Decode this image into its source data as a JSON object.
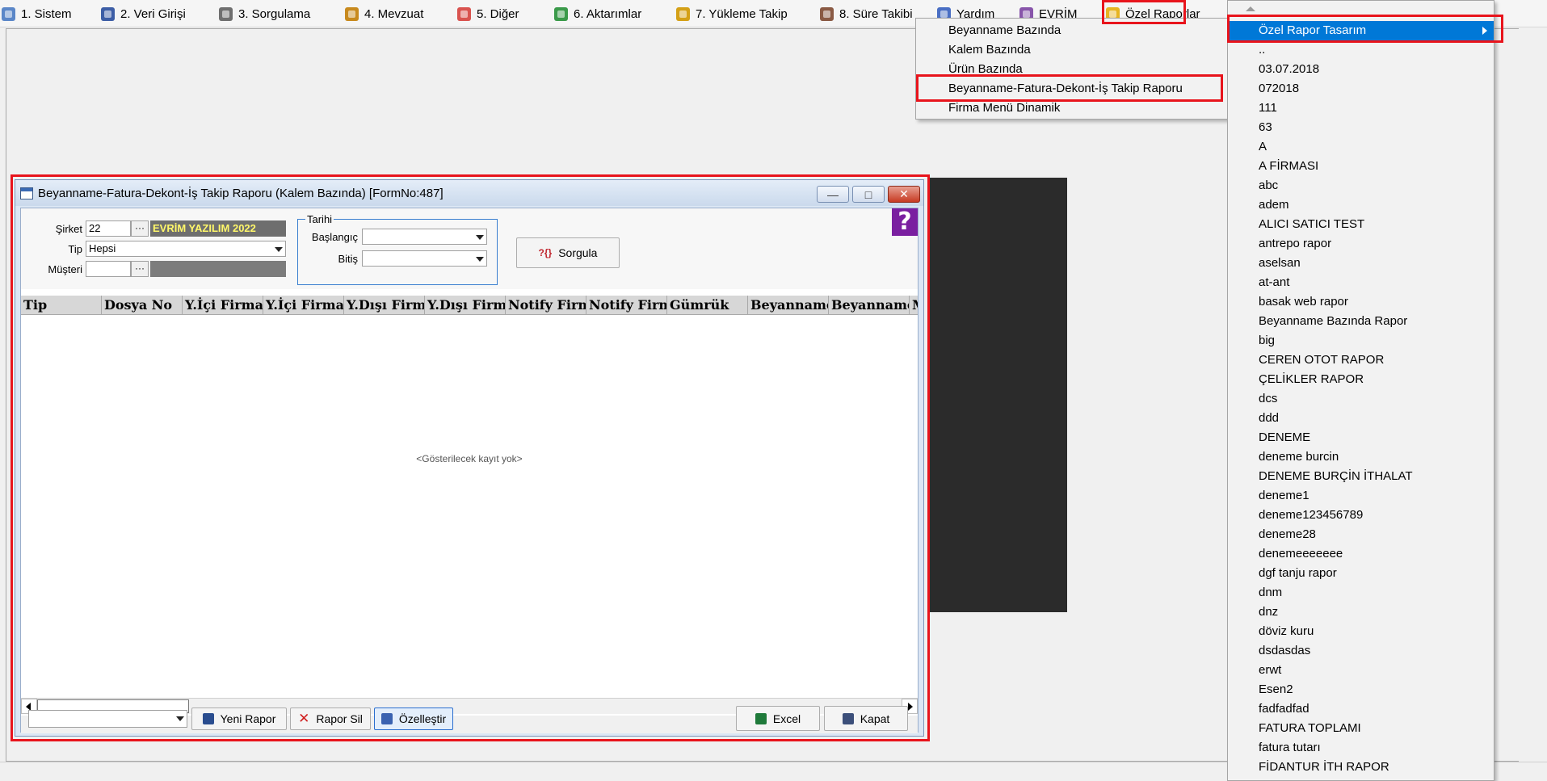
{
  "menubar": {
    "items": [
      {
        "label": "1.  Sistem"
      },
      {
        "label": "2.  Veri Girişi"
      },
      {
        "label": "3.  Sorgulama"
      },
      {
        "label": "4.  Mevzuat"
      },
      {
        "label": "5.  Diğer"
      },
      {
        "label": "6.  Aktarımlar"
      },
      {
        "label": "7.  Yükleme Takip"
      },
      {
        "label": "8. Süre Takibi"
      },
      {
        "label": "Yardım"
      },
      {
        "label": "EVRİM"
      },
      {
        "label": "Özel Raporlar"
      }
    ]
  },
  "ozel_raporlar_menu": {
    "items": [
      "Beyanname Bazında",
      "Kalem Bazında",
      "Ürün Bazında",
      "Beyanname-Fatura-Dekont-İş Takip Raporu",
      "Firma Menü Dinamik"
    ]
  },
  "submenu": {
    "items": [
      "Özel Rapor Tasarım",
      "..",
      "03.07.2018",
      "072018",
      "111",
      "63",
      "A",
      "A FİRMASI",
      "abc",
      "adem",
      "ALICI SATICI TEST",
      "antrepo rapor",
      "aselsan",
      "at-ant",
      "basak web rapor",
      "Beyanname Bazında Rapor",
      "big",
      "CEREN OTOT RAPOR",
      "ÇELİKLER RAPOR",
      "dcs",
      "ddd",
      "DENEME",
      "deneme burcin",
      "DENEME BURÇİN İTHALAT",
      "deneme1",
      "deneme123456789",
      "deneme28",
      "denemeeeeeee",
      "dgf tanju rapor",
      "dnm",
      "dnz",
      "döviz kuru",
      "dsdasdas",
      "erwt",
      "Esen2",
      "fadfadfad",
      "FATURA TOPLAMI",
      "fatura tutarı",
      "FİDANTUR İTH RAPOR"
    ]
  },
  "form": {
    "title": "Beyanname-Fatura-Dekont-İş Takip Raporu (Kalem Bazında) [FormNo:487]",
    "win_buttons": {
      "minimize": "—",
      "maximize": "□",
      "close": "✕"
    },
    "filters": {
      "sirket_label": "Şirket",
      "sirket_value": "22",
      "company_name": "EVRİM YAZILIM  2022",
      "tip_label": "Tip",
      "tip_value": "Hepsi",
      "musteri_label": "Müşteri",
      "musteri_value": "",
      "ellipsis": "···",
      "tarih_legend": "Tarihi",
      "baslangic_label": "Başlangıç",
      "baslangic_value": "",
      "bitis_label": "Bitiş",
      "bitis_value": ""
    },
    "sorgula_label": "Sorgula",
    "help": "?",
    "grid": {
      "columns": [
        "Tip",
        "Dosya No",
        "Y.İçi Firma",
        "Y.İçi Firma Adı",
        "Y.Dışı Firma",
        "Y.Dışı Firma",
        "Notify Firma",
        "Notify Firma",
        "Gümrük",
        "Beyanname",
        "Beyanname",
        "M"
      ],
      "empty_text": "<Gösterilecek kayıt yok>"
    },
    "bottom": {
      "report_select_value": "",
      "yeni_rapor": "Yeni Rapor",
      "rapor_sil": "Rapor Sil",
      "ozellestir": "Özelleştir",
      "excel": "Excel",
      "kapat": "Kapat"
    }
  },
  "colors": {
    "highlight": "#e8141c",
    "selection": "#0078d7",
    "company_text": "#fff76a"
  }
}
